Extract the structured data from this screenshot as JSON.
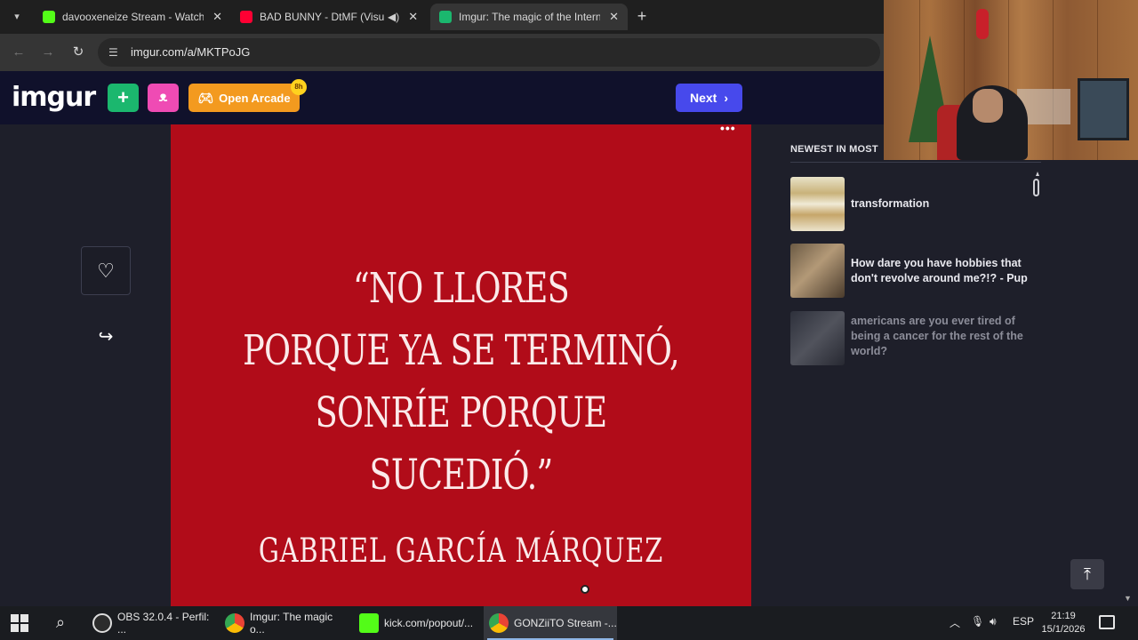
{
  "browser": {
    "tabs": [
      {
        "title": "davooxeneize Stream - Watch L",
        "favicon_color": "#53fc18"
      },
      {
        "title": "BAD BUNNY - DtMF (Visual",
        "favicon_color": "#ff0033"
      },
      {
        "title": "Imgur: The magic of the Interne",
        "favicon_color": "#1bb76e"
      }
    ],
    "url": "imgur.com/a/MKTPoJG"
  },
  "header": {
    "logo": "imgur",
    "arcade_label": "Open Arcade",
    "arcade_badge": "8h",
    "next_label": "Next"
  },
  "post": {
    "quote": "“NO LLORES\nPORQUE YA SE TERMINÓ,\nSONRÍE PORQUE SUCEDIÓ.”",
    "author": "GABRIEL GARCÍA MÁRQUEZ",
    "background_color": "#b10c19"
  },
  "sidebar": {
    "title": "NEWEST IN MOST",
    "items": [
      {
        "text": "transformation"
      },
      {
        "text": "How dare you have hobbies that don't revolve around me?!? - Pup"
      },
      {
        "text": "americans are you ever tired of being a cancer for the rest of the world?"
      }
    ]
  },
  "taskbar": {
    "items": [
      {
        "label": "OBS 32.0.4 - Perfil: ..."
      },
      {
        "label": "Imgur: The magic o..."
      },
      {
        "label": "kick.com/popout/..."
      },
      {
        "label": "GONZiiTO Stream -..."
      }
    ],
    "language": "ESP",
    "time": "21:19",
    "date": "15/1/2026"
  }
}
